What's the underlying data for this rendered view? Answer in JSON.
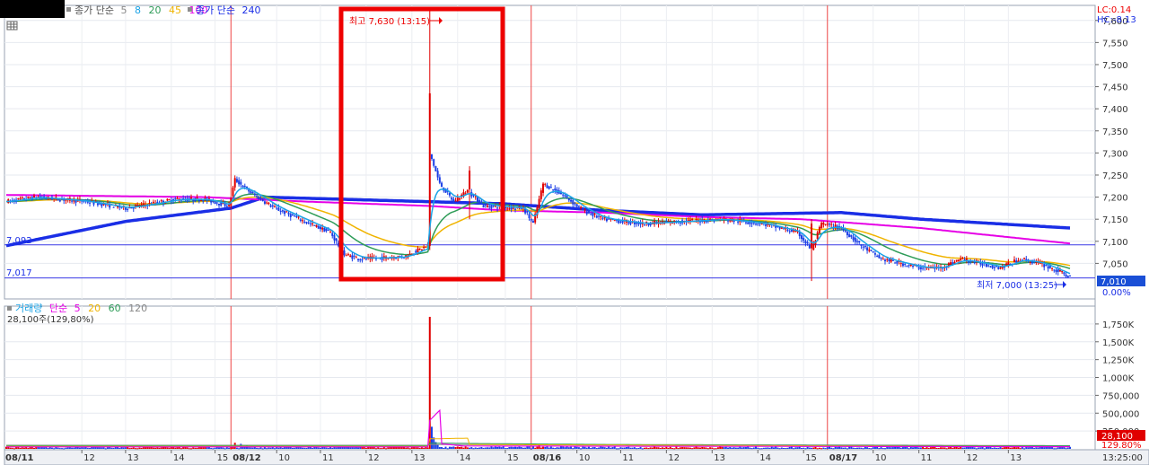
{
  "price_legend": {
    "label": "종가 단순",
    "periods": [
      {
        "label": "5",
        "color": "#1aa3e6"
      },
      {
        "label": "8",
        "color": "#1aa3e6"
      },
      {
        "label": "20",
        "color": "#2e9c58"
      },
      {
        "label": "45",
        "color": "#f0b400"
      },
      {
        "label": "100",
        "color": "#e600e6"
      }
    ],
    "long_label": "종가 단순",
    "long_period": "240",
    "long_color": "#1a2ee6"
  },
  "volume_legend": {
    "label": "거래량",
    "ma_label": "단순",
    "periods": [
      {
        "label": "5",
        "color": "#e600e6"
      },
      {
        "label": "20",
        "color": "#f0b400"
      },
      {
        "label": "60",
        "color": "#2e9c58"
      },
      {
        "label": "120",
        "color": "#888888"
      }
    ],
    "summary": "28,100주(129,80%)"
  },
  "corner_info": {
    "lc": "LC:0.14",
    "hc": "HC:-8.13"
  },
  "annotations": {
    "high": "최고 7,630 (13:15)",
    "low": "최저 7,000 (13:25)",
    "ref_high": "7,092",
    "ref_low": "7,017"
  },
  "price_badge": {
    "value": "7,010",
    "pct": "0.00%"
  },
  "volume_badge": {
    "value": "28,100",
    "pct": "129.80%"
  },
  "time_label": "13:25:00",
  "highlight_color": "#ee0000",
  "chart_data": [
    {
      "type": "candlestick",
      "title": "",
      "ylim": [
        7000,
        7630
      ],
      "yticks": [
        {
          "v": 7050,
          "label": "7,050"
        },
        {
          "v": 7100,
          "label": "7,100"
        },
        {
          "v": 7150,
          "label": "7,150"
        },
        {
          "v": 7200,
          "label": "7,200"
        },
        {
          "v": 7250,
          "label": "7,250"
        },
        {
          "v": 7300,
          "label": "7,300"
        },
        {
          "v": 7350,
          "label": "7,350"
        },
        {
          "v": 7400,
          "label": "7,400"
        },
        {
          "v": 7450,
          "label": "7,450"
        },
        {
          "v": 7500,
          "label": "7,500"
        },
        {
          "v": 7550,
          "label": "7,550"
        },
        {
          "v": 7600,
          "label": "7,600"
        }
      ],
      "price_path": [
        [
          0,
          7190
        ],
        [
          15,
          7200
        ],
        [
          40,
          7190
        ],
        [
          60,
          7175
        ],
        [
          85,
          7195
        ],
        [
          100,
          7195
        ],
        [
          112,
          7180
        ],
        [
          115,
          7240
        ],
        [
          123,
          7210
        ],
        [
          135,
          7175
        ],
        [
          150,
          7145
        ],
        [
          163,
          7120
        ],
        [
          170,
          7070
        ],
        [
          178,
          7060
        ],
        [
          200,
          7065
        ],
        [
          212,
          7090
        ],
        [
          213,
          7300
        ],
        [
          218,
          7230
        ],
        [
          225,
          7190
        ],
        [
          232,
          7215
        ],
        [
          240,
          7180
        ],
        [
          260,
          7175
        ],
        [
          265,
          7140
        ],
        [
          270,
          7230
        ],
        [
          280,
          7205
        ],
        [
          290,
          7170
        ],
        [
          300,
          7150
        ],
        [
          320,
          7140
        ],
        [
          360,
          7150
        ],
        [
          380,
          7140
        ],
        [
          398,
          7120
        ],
        [
          405,
          7080
        ],
        [
          410,
          7140
        ],
        [
          420,
          7130
        ],
        [
          430,
          7090
        ],
        [
          440,
          7060
        ],
        [
          460,
          7040
        ],
        [
          470,
          7040
        ],
        [
          480,
          7060
        ],
        [
          500,
          7040
        ],
        [
          510,
          7060
        ],
        [
          520,
          7050
        ],
        [
          535,
          7020
        ]
      ],
      "spikes": [
        {
          "bar": 213,
          "high": 7630,
          "low": 7080
        },
        {
          "bar": 233,
          "high": 7270,
          "low": 7150
        },
        {
          "bar": 405,
          "high": 7150,
          "low": 7010
        }
      ],
      "ma_smooth": [
        {
          "name": "5",
          "color": "#1aa3e6",
          "alpha": 0.22
        },
        {
          "name": "20",
          "color": "#2e9c58",
          "alpha": 0.07
        },
        {
          "name": "45",
          "color": "#f0b400",
          "alpha": 0.035
        }
      ],
      "ma_100": [
        [
          0,
          7205
        ],
        [
          100,
          7200
        ],
        [
          150,
          7190
        ],
        [
          213,
          7180
        ],
        [
          250,
          7170
        ],
        [
          300,
          7165
        ],
        [
          350,
          7155
        ],
        [
          400,
          7150
        ],
        [
          460,
          7130
        ],
        [
          535,
          7095
        ]
      ],
      "ma_240": [
        [
          0,
          7090
        ],
        [
          60,
          7145
        ],
        [
          113,
          7175
        ],
        [
          130,
          7200
        ],
        [
          170,
          7195
        ],
        [
          250,
          7185
        ],
        [
          300,
          7170
        ],
        [
          350,
          7160
        ],
        [
          420,
          7165
        ],
        [
          460,
          7150
        ],
        [
          535,
          7130
        ]
      ],
      "ref_lines": [
        7092,
        7017
      ],
      "day_separators": [
        {
          "bar": 113,
          "label": "08/12"
        },
        {
          "bar": 264,
          "label": "08/16"
        },
        {
          "bar": 413,
          "label": "08/17"
        }
      ],
      "hour_labels": [
        {
          "bar": 38,
          "label": "12"
        },
        {
          "bar": 60,
          "label": "13"
        },
        {
          "bar": 83,
          "label": "14"
        },
        {
          "bar": 105,
          "label": "15"
        },
        {
          "bar": 136,
          "label": "10"
        },
        {
          "bar": 158,
          "label": "11"
        },
        {
          "bar": 181,
          "label": "12"
        },
        {
          "bar": 204,
          "label": "13"
        },
        {
          "bar": 227,
          "label": "14"
        },
        {
          "bar": 251,
          "label": "15"
        },
        {
          "bar": 287,
          "label": "10"
        },
        {
          "bar": 309,
          "label": "11"
        },
        {
          "bar": 332,
          "label": "12"
        },
        {
          "bar": 355,
          "label": "13"
        },
        {
          "bar": 378,
          "label": "14"
        },
        {
          "bar": 401,
          "label": "15"
        },
        {
          "bar": 436,
          "label": "10"
        },
        {
          "bar": 459,
          "label": "11"
        },
        {
          "bar": 482,
          "label": "12"
        },
        {
          "bar": 504,
          "label": "13"
        }
      ],
      "first_day_label": "08/11",
      "num_bars": 536
    },
    {
      "type": "bar",
      "title": "",
      "ylim": [
        0,
        1950000
      ],
      "yticks": [
        {
          "v": 250000,
          "label": "250,000"
        },
        {
          "v": 500000,
          "label": "500,000"
        },
        {
          "v": 750000,
          "label": "750,000"
        },
        {
          "v": 1000000,
          "label": "1,000K"
        },
        {
          "v": 1250000,
          "label": "1,250K"
        },
        {
          "v": 1500000,
          "label": "1,500K"
        },
        {
          "v": 1750000,
          "label": "1,750K"
        }
      ],
      "base_volume": 28000,
      "volume_spikes": [
        {
          "bar": 213,
          "value": 1850000
        },
        {
          "bar": 214,
          "value": 310000
        },
        {
          "bar": 215,
          "value": 160000
        },
        {
          "bar": 216,
          "value": 95000
        },
        {
          "bar": 217,
          "value": 60000
        },
        {
          "bar": 115,
          "value": 85000
        },
        {
          "bar": 118,
          "value": 70000
        },
        {
          "bar": 121,
          "value": 55000
        },
        {
          "bar": 268,
          "value": 60000
        },
        {
          "bar": 272,
          "value": 45000
        },
        {
          "bar": 414,
          "value": 40000
        },
        {
          "bar": 535,
          "value": 28100
        }
      ],
      "vol_ma5": [
        [
          0,
          28000
        ],
        [
          212,
          28000
        ],
        [
          213,
          400000
        ],
        [
          218,
          540000
        ],
        [
          219,
          70000
        ],
        [
          230,
          40000
        ],
        [
          535,
          30000
        ]
      ],
      "vol_ma20": [
        [
          0,
          35000
        ],
        [
          212,
          35000
        ],
        [
          213,
          140000
        ],
        [
          232,
          150000
        ],
        [
          233,
          60000
        ],
        [
          535,
          30000
        ]
      ],
      "vol_ma60": [
        [
          0,
          45000
        ],
        [
          212,
          45000
        ],
        [
          213,
          80000
        ],
        [
          260,
          70000
        ],
        [
          330,
          55000
        ],
        [
          535,
          40000
        ]
      ],
      "vol_ma120": [
        [
          0,
          50000
        ],
        [
          212,
          50000
        ],
        [
          213,
          60000
        ],
        [
          330,
          60000
        ],
        [
          535,
          45000
        ]
      ]
    }
  ]
}
